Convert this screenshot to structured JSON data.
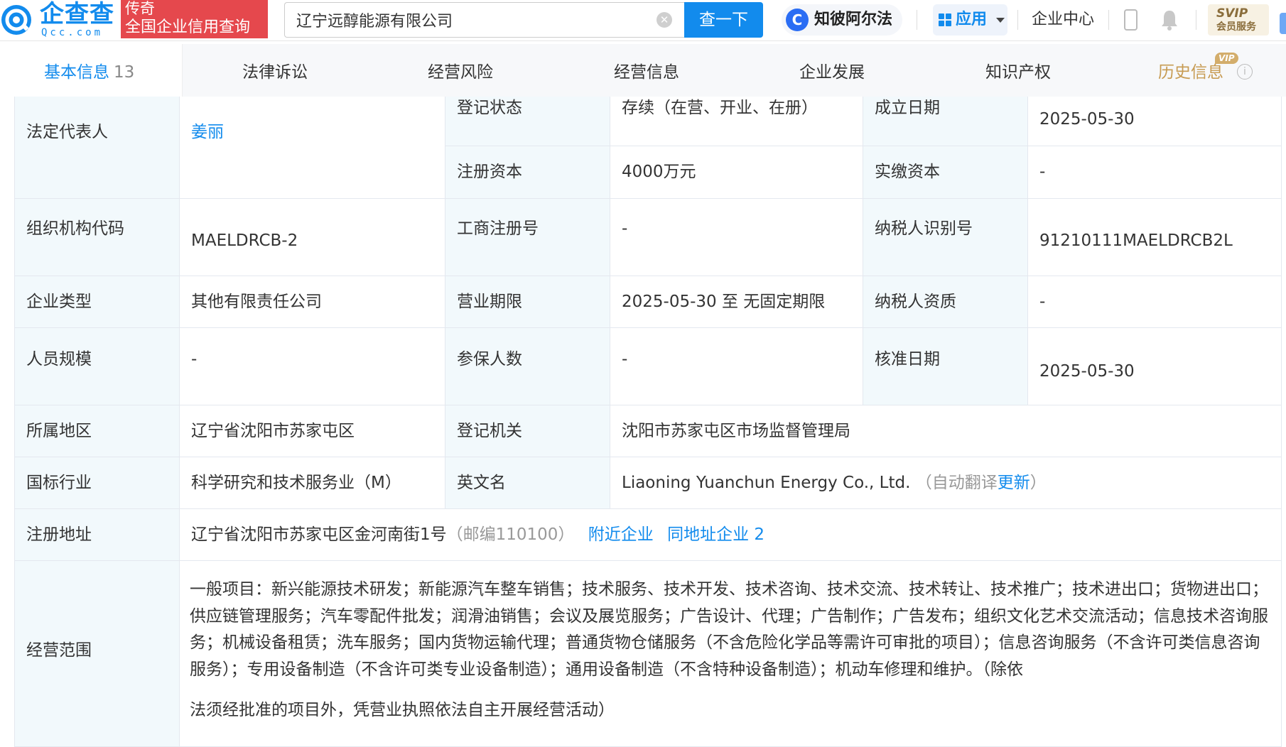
{
  "header": {
    "logo_text": "企查查",
    "logo_sub": "Qcc.com",
    "promo_top": "传奇",
    "promo_bottom": "全国企业信用查询",
    "search_value": "辽宁远醇能源有限公司",
    "search_button": "查一下",
    "alpha_label": "知彼阿尔法",
    "apps_label": "应用",
    "enterprise_center": "企业中心",
    "svip_top": "SVIP",
    "svip_bottom": "会员服务",
    "accent_color": "#128bed",
    "promo_color": "#e5484d"
  },
  "tabs": [
    {
      "label": "基本信息",
      "count": "13"
    },
    {
      "label": "法律诉讼"
    },
    {
      "label": "经营风险"
    },
    {
      "label": "经营信息"
    },
    {
      "label": "企业发展"
    },
    {
      "label": "知识产权"
    },
    {
      "label": "历史信息",
      "badge": "VIP"
    }
  ],
  "info": {
    "legal_rep_label": "法定代表人",
    "legal_rep_value": "姜丽",
    "reg_status_label": "登记状态",
    "reg_status_value": "存续（在营、开业、在册）",
    "est_date_label": "成立日期",
    "est_date_value": "2025-05-30",
    "reg_capital_label": "注册资本",
    "reg_capital_value": "4000万元",
    "paid_capital_label": "实缴资本",
    "paid_capital_value": "-",
    "org_code_label": "组织机构代码",
    "org_code_value": "MAELDRCB-2",
    "biz_reg_no_label": "工商注册号",
    "biz_reg_no_value": "-",
    "taxpayer_id_label": "纳税人识别号",
    "taxpayer_id_value": "91210111MAELDRCB2L",
    "company_type_label": "企业类型",
    "company_type_value": "其他有限责任公司",
    "biz_term_label": "营业期限",
    "biz_term_value": "2025-05-30 至 无固定期限",
    "taxpayer_qual_label": "纳税人资质",
    "taxpayer_qual_value": "-",
    "staff_size_label": "人员规模",
    "staff_size_value": "-",
    "insured_label": "参保人数",
    "insured_value": "-",
    "approval_date_label": "核准日期",
    "approval_date_value": "2025-05-30",
    "region_label": "所属地区",
    "region_value": "辽宁省沈阳市苏家屯区",
    "reg_authority_label": "登记机关",
    "reg_authority_value": "沈阳市苏家屯区市场监督管理局",
    "industry_label": "国标行业",
    "industry_value": "科学研究和技术服务业（M）",
    "english_name_label": "英文名",
    "english_name_value": "Liaoning Yuanchun Energy Co., Ltd.",
    "english_name_note_open": "（自动翻译",
    "english_name_update": "更新",
    "english_name_note_close": "）",
    "address_label": "注册地址",
    "address_value": "辽宁省沈阳市苏家屯区金河南街1号",
    "address_postcode": "（邮编110100）",
    "nearby_link": "附近企业",
    "same_address_link": "同地址企业 2",
    "scope_label": "经营范围",
    "scope_value": "一般项目：新兴能源技术研发；新能源汽车整车销售；技术服务、技术开发、技术咨询、技术交流、技术转让、技术推广；技术进出口；货物进出口；供应链管理服务；汽车零配件批发；润滑油销售；会议及展览服务；广告设计、代理；广告制作；广告发布；组织文化艺术交流活动；信息技术咨询服务；机械设备租赁；洗车服务；国内货物运输代理；普通货物仓储服务（不含危险化学品等需许可审批的项目）；信息咨询服务（不含许可类信息咨询服务）；专用设备制造（不含许可类专业设备制造）；通用设备制造（不含特种设备制造）；机动车修理和维护。（除依",
    "scope_tail": "法须经批准的项目外，凭营业执照依法自主开展经营活动）"
  }
}
